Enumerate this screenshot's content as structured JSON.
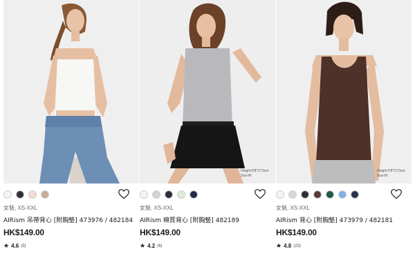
{
  "products": [
    {
      "photo_hint": "",
      "swatches": [
        "#f4f4f4",
        "#2f3136",
        "#f3dcd2",
        "#c9ad96"
      ],
      "meta": "女裝, XS-XXL",
      "name": "AIRism 吊帶背心 [附胸墊] 473976 / 482184",
      "price": "HK$149.00",
      "rating": "4.6",
      "count": "(5)"
    },
    {
      "photo_hint": "Height:5'8\"/173cm\nSize:M",
      "swatches": [
        "#f4f4f4",
        "#d3d3d3",
        "#2c2f3a",
        "#dcebd6",
        "#242b44"
      ],
      "meta": "女裝, XS-XXL",
      "name": "AIRism 棉質背心 [附胸墊] 482189",
      "price": "HK$149.00",
      "rating": "4.2",
      "count": "(6)"
    },
    {
      "photo_hint": "Height:5'8\"/173cm\nSize:M",
      "swatches": [
        "#f4f4f4",
        "#d8d8d8",
        "#2f3034",
        "#5a3a33",
        "#1f5a42",
        "#7fb0ea",
        "#283250"
      ],
      "meta": "女裝, XS-XXL",
      "name": "AIRism 背心 [附胸墊] 473979 / 482181",
      "price": "HK$149.00",
      "rating": "4.8",
      "count": "(23)"
    }
  ],
  "icons": {
    "favorite": "heart-outline-icon",
    "rating": "star-icon"
  }
}
